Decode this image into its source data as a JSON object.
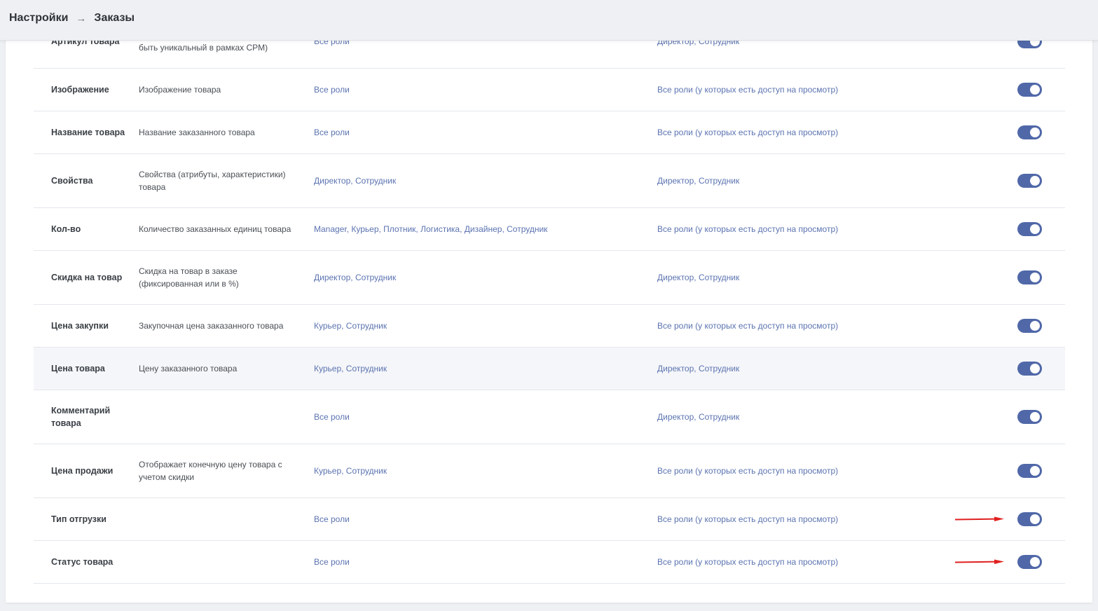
{
  "breadcrumb": {
    "items": [
      "Настройки",
      "Заказы"
    ],
    "separator": "→"
  },
  "rows": [
    {
      "name": "Артикул товара",
      "desc": "Артикул заказанного товара (должен быть уникальный в рамках CPM)",
      "roles": "Все роли",
      "view": "Директор, Сотрудник",
      "enabled": true,
      "arrow": false
    },
    {
      "name": "Изображение",
      "desc": "Изображение товара",
      "roles": "Все роли",
      "view": "Все роли (у которых есть доступ на просмотр)",
      "enabled": true,
      "arrow": false
    },
    {
      "name": "Название товара",
      "desc": "Название заказанного товара",
      "roles": "Все роли",
      "view": "Все роли (у которых есть доступ на просмотр)",
      "enabled": true,
      "arrow": false
    },
    {
      "name": "Свойства",
      "desc": "Свойства (атрибуты, характеристики) товара",
      "roles": "Директор, Сотрудник",
      "view": "Директор, Сотрудник",
      "enabled": true,
      "arrow": false
    },
    {
      "name": "Кол-во",
      "desc": "Количество заказанных единиц товара",
      "roles": "Manager, Курьер, Плотник, Логистика, Дизайнер, Сотрудник",
      "view": "Все роли (у которых есть доступ на просмотр)",
      "enabled": true,
      "arrow": false
    },
    {
      "name": "Скидка на товар",
      "desc": "Скидка на товар в заказе (фиксированная или в %)",
      "roles": "Директор, Сотрудник",
      "view": "Директор, Сотрудник",
      "enabled": true,
      "arrow": false
    },
    {
      "name": "Цена закупки",
      "desc": "Закупочная цена заказанного товара",
      "roles": "Курьер, Сотрудник",
      "view": "Все роли (у которых есть доступ на просмотр)",
      "enabled": true,
      "arrow": false
    },
    {
      "name": "Цена товара",
      "desc": "Цену заказанного товара",
      "roles": "Курьер, Сотрудник",
      "view": "Директор, Сотрудник",
      "enabled": true,
      "arrow": false
    },
    {
      "name": "Комментарий товара",
      "desc": "",
      "roles": "Все роли",
      "view": "Директор, Сотрудник",
      "enabled": true,
      "arrow": false
    },
    {
      "name": "Цена продажи",
      "desc": "Отображает конечную цену товара с учетом скидки",
      "roles": "Курьер, Сотрудник",
      "view": "Все роли (у которых есть доступ на просмотр)",
      "enabled": true,
      "arrow": false
    },
    {
      "name": "Тип отгрузки",
      "desc": "",
      "roles": "Все роли",
      "view": "Все роли (у которых есть доступ на просмотр)",
      "enabled": true,
      "arrow": true
    },
    {
      "name": "Статус товара",
      "desc": "",
      "roles": "Все роли",
      "view": "Все роли (у которых есть доступ на просмотр)",
      "enabled": true,
      "arrow": true
    }
  ],
  "colors": {
    "toggle_on": "#5068a8",
    "link": "#5b73b0",
    "arrow": "#e02020"
  }
}
